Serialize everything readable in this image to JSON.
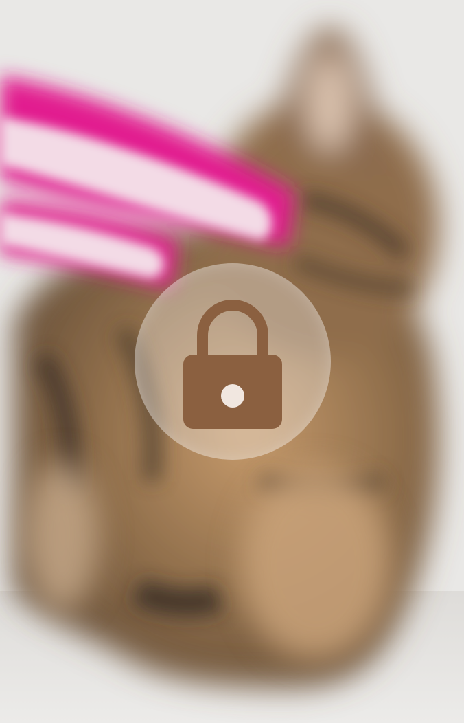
{
  "colors": {
    "background": "#e9e8e6",
    "accent_pink": "#e21f8f",
    "fur_brown": "#8a6a48",
    "fur_tan": "#c79b6c",
    "fur_dark": "#3f3227",
    "lock_overlay": "rgba(255,255,255,0.32)",
    "lock_icon": "#8b6040"
  },
  "overlay": {
    "icon": "lock-icon",
    "state": "locked"
  }
}
